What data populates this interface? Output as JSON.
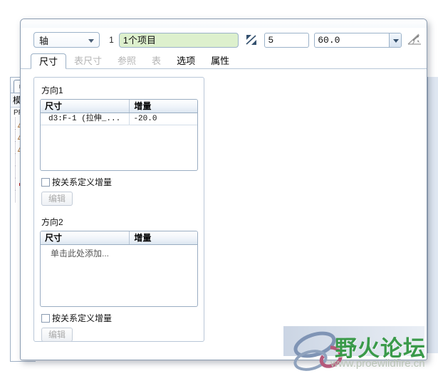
{
  "toolbar": {
    "pattern_type": "轴",
    "item_count_label": "1",
    "collector_value": "1个项目",
    "flip_icon": "direction-flip-icon",
    "members_value": "5",
    "angle_value": "60.0",
    "angle_dropdown_icon": "chevron-down-icon",
    "dimension_icon": "angular-dimension-icon"
  },
  "tabs": [
    {
      "label": "尺寸",
      "state": "active"
    },
    {
      "label": "表尺寸",
      "state": "disabled"
    },
    {
      "label": "参照",
      "state": "disabled"
    },
    {
      "label": "表",
      "state": "disabled"
    },
    {
      "label": "选项",
      "state": "enabled"
    },
    {
      "label": "属性",
      "state": "enabled"
    }
  ],
  "panel": {
    "direction1": {
      "title": "方向1",
      "columns": [
        "尺寸",
        "增量"
      ],
      "rows": [
        {
          "dimension": "d3:F-1 (拉伸_...",
          "increment": "-20.0"
        }
      ],
      "relation_checkbox_label": "按关系定义增量",
      "relation_checked": false,
      "edit_button": "编辑",
      "edit_enabled": false
    },
    "direction2": {
      "title": "方向2",
      "columns": [
        "尺寸",
        "增量"
      ],
      "placeholder": "单击此处添加...",
      "rows": [],
      "relation_checkbox_label": "按关系定义增量",
      "relation_checked": false,
      "edit_button": "编辑",
      "edit_enabled": false
    }
  },
  "model_tree": {
    "tab_icon": "model-tree-tab-icon",
    "title": "模型树",
    "root": "PRT",
    "items": [
      {
        "icon": "datum-plane-icon",
        "label": ""
      },
      {
        "icon": "datum-plane-icon",
        "label": ""
      },
      {
        "icon": "datum-plane-icon",
        "label": ""
      },
      {
        "icon": "datum-axis-icon",
        "label": ""
      },
      {
        "icon": "coordinate-system-icon",
        "label": ""
      },
      {
        "icon": "extrude-feature-icon",
        "label": ""
      },
      {
        "icon": "pattern-feature-icon",
        "label": ""
      }
    ]
  },
  "viewport": {
    "name": "graphics-area"
  },
  "watermark": {
    "title": "野火论坛",
    "url": "www.proewildfire.cn"
  },
  "colors": {
    "collector_green": "#ddf0cd",
    "viewport_top": "#c9d9ec",
    "viewport_bottom": "#a9c1de",
    "watermark_green": "#3a9a4a"
  }
}
